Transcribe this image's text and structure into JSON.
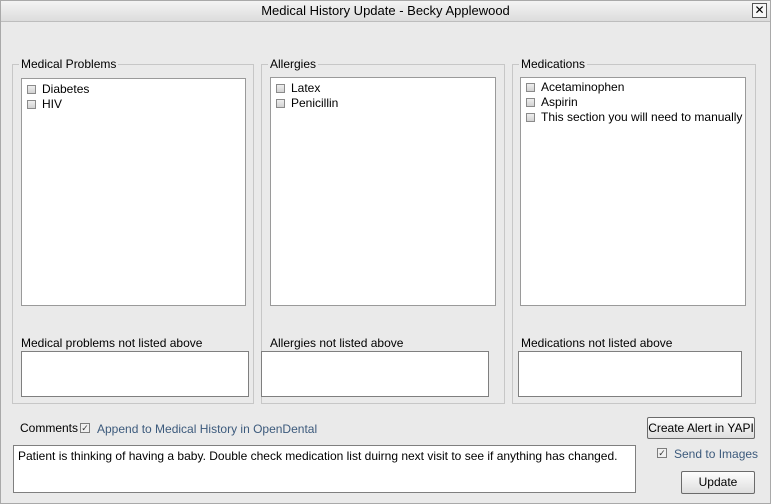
{
  "window": {
    "title": "Medical History Update - Becky Applewood",
    "close_glyph": "✕"
  },
  "medical_problems": {
    "legend": "Medical Problems",
    "items": [
      {
        "label": "Diabetes",
        "checked": false
      },
      {
        "label": "HIV",
        "checked": false
      }
    ],
    "not_listed_label": "Medical problems not listed above",
    "not_listed_value": ""
  },
  "allergies": {
    "legend": "Allergies",
    "items": [
      {
        "label": "Latex",
        "checked": false
      },
      {
        "label": "Penicillin",
        "checked": false
      }
    ],
    "not_listed_label": "Allergies not listed above",
    "not_listed_value": ""
  },
  "medications": {
    "legend": "Medications",
    "items": [
      {
        "label": "Acetaminophen",
        "checked": false
      },
      {
        "label": "Aspirin",
        "checked": false
      },
      {
        "label": "This section you will need to manually put ir",
        "checked": false
      }
    ],
    "not_listed_label": "Medications not listed above",
    "not_listed_value": ""
  },
  "comments": {
    "label": "Comments",
    "append_label": "Append to Medical History in OpenDental",
    "append_checked": true,
    "value": "Patient is thinking of having a baby. Double check medication list duirng next visit to see if anything has changed."
  },
  "actions": {
    "create_alert_label": "Create Alert in YAPI",
    "send_to_images_label": "Send to Images",
    "send_to_images_checked": true,
    "update_label": "Update"
  }
}
